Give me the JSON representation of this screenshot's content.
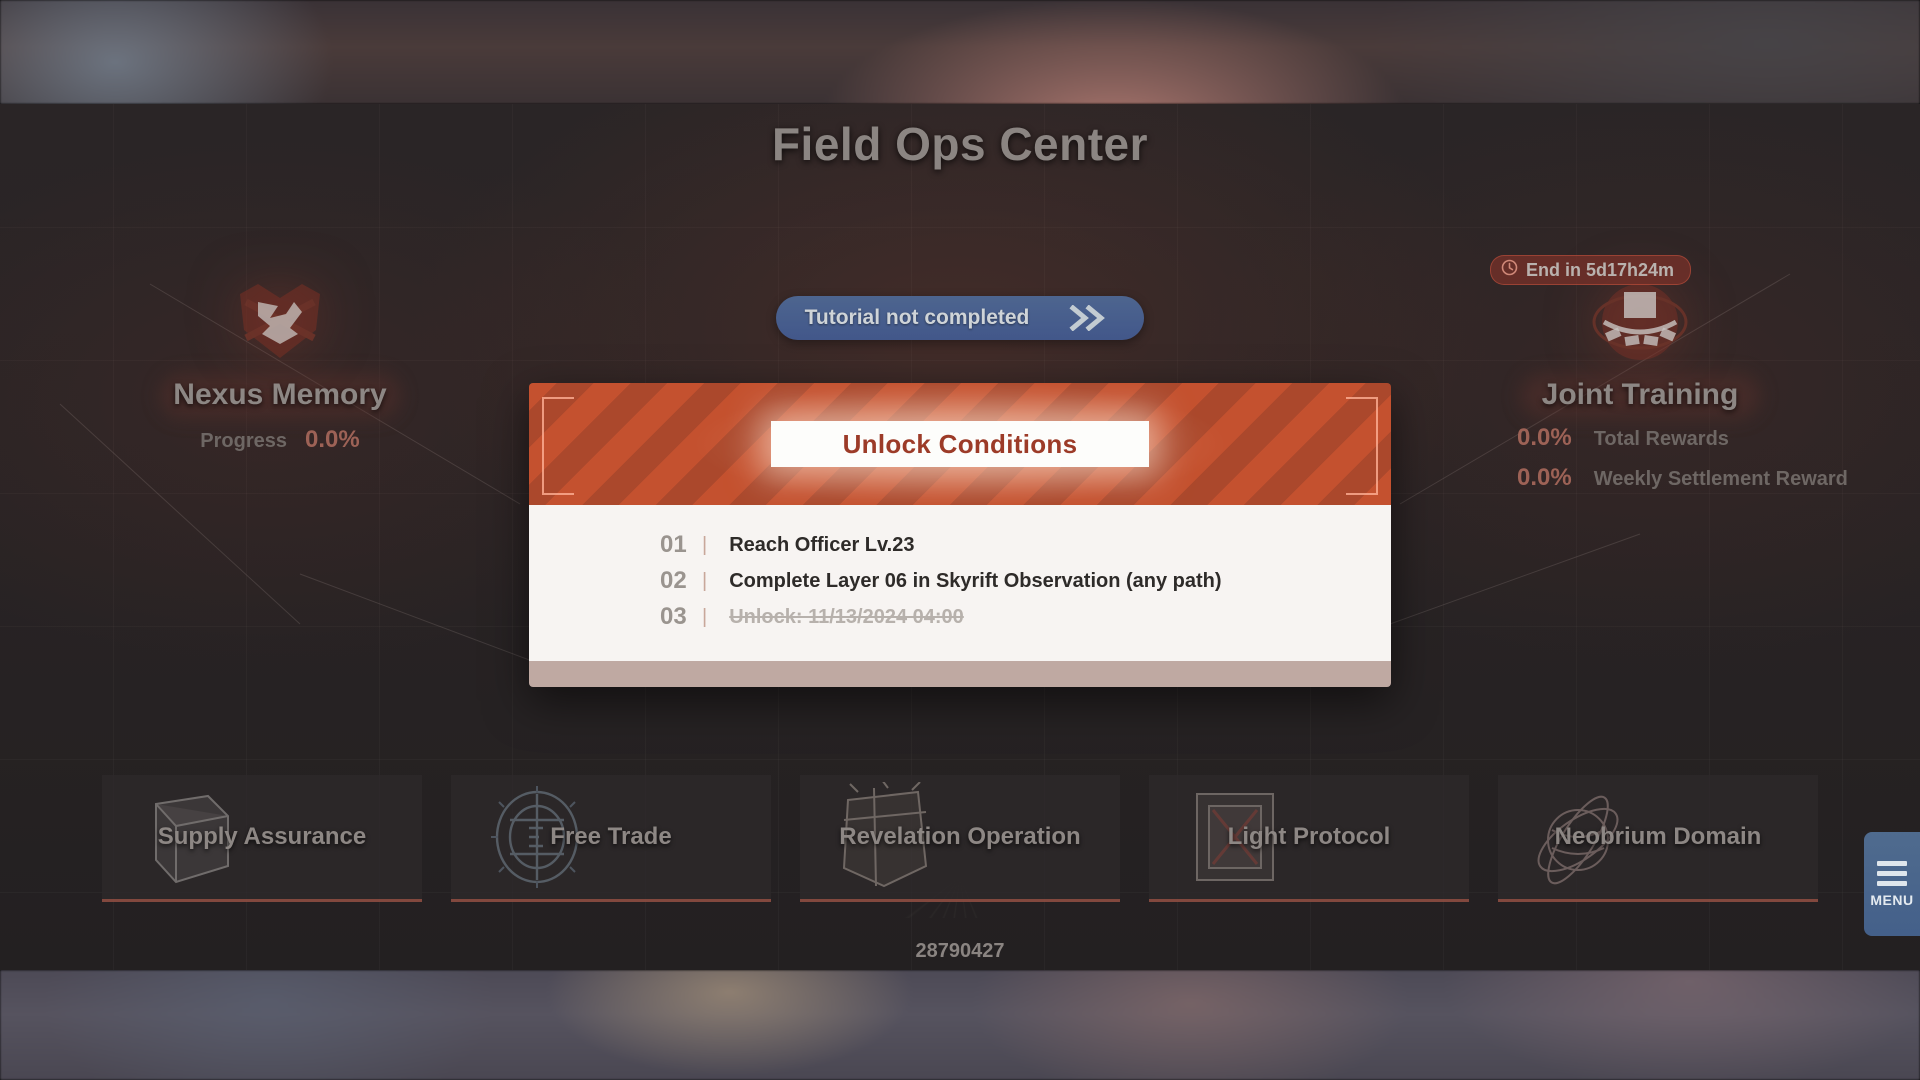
{
  "header": {
    "title": "Field Ops Center",
    "tutorial_button": {
      "label": "Tutorial not completed",
      "chevron_icon": "double-chevron-right-icon"
    }
  },
  "left_panel": {
    "emblem_icon": "crossed-swords-crest-icon",
    "name": "Nexus Memory",
    "stats": [
      {
        "label": "Progress",
        "value": "0.0%"
      }
    ]
  },
  "right_panel": {
    "timer": {
      "clock_icon": "clock-icon",
      "text": "End in 5d17h24m"
    },
    "emblem_icon": "arena-dome-icon",
    "name": "Joint Training",
    "stats": [
      {
        "value": "0.0%",
        "label": "Total Rewards"
      },
      {
        "value": "0.0%",
        "label": "Weekly Settlement Reward"
      }
    ]
  },
  "dialog": {
    "title": "Unlock Conditions",
    "conditions": [
      {
        "num": "01",
        "sep": "|",
        "text": "Reach Officer Lv.23",
        "done": false
      },
      {
        "num": "02",
        "sep": "|",
        "text": "Complete Layer 06 in Skyrift Observation (any path)",
        "done": false
      },
      {
        "num": "03",
        "sep": "|",
        "text": "Unlock: 11/13/2024 04:00",
        "done": true
      }
    ]
  },
  "tabs": [
    {
      "label": "Supply Assurance",
      "art_icon": "crate-box-icon"
    },
    {
      "label": "Free Trade",
      "art_icon": "compass-wheel-icon"
    },
    {
      "label": "Revelation Operation",
      "art_icon": "banner-sigil-icon"
    },
    {
      "label": "Light Protocol",
      "art_icon": "framed-x-icon"
    },
    {
      "label": "Neobrium Domain",
      "art_icon": "orbital-rings-icon"
    }
  ],
  "uid": "28790427",
  "menu": {
    "icon": "hamburger-icon",
    "label": "MENU"
  },
  "colors": {
    "accent_red": "#c4512f",
    "accent_blue": "#4d658f",
    "panel_bg": "#f7f4f2",
    "panel_footer": "#bfa9a2",
    "title_text": "#8b8582",
    "stat_value": "#9d6256"
  }
}
